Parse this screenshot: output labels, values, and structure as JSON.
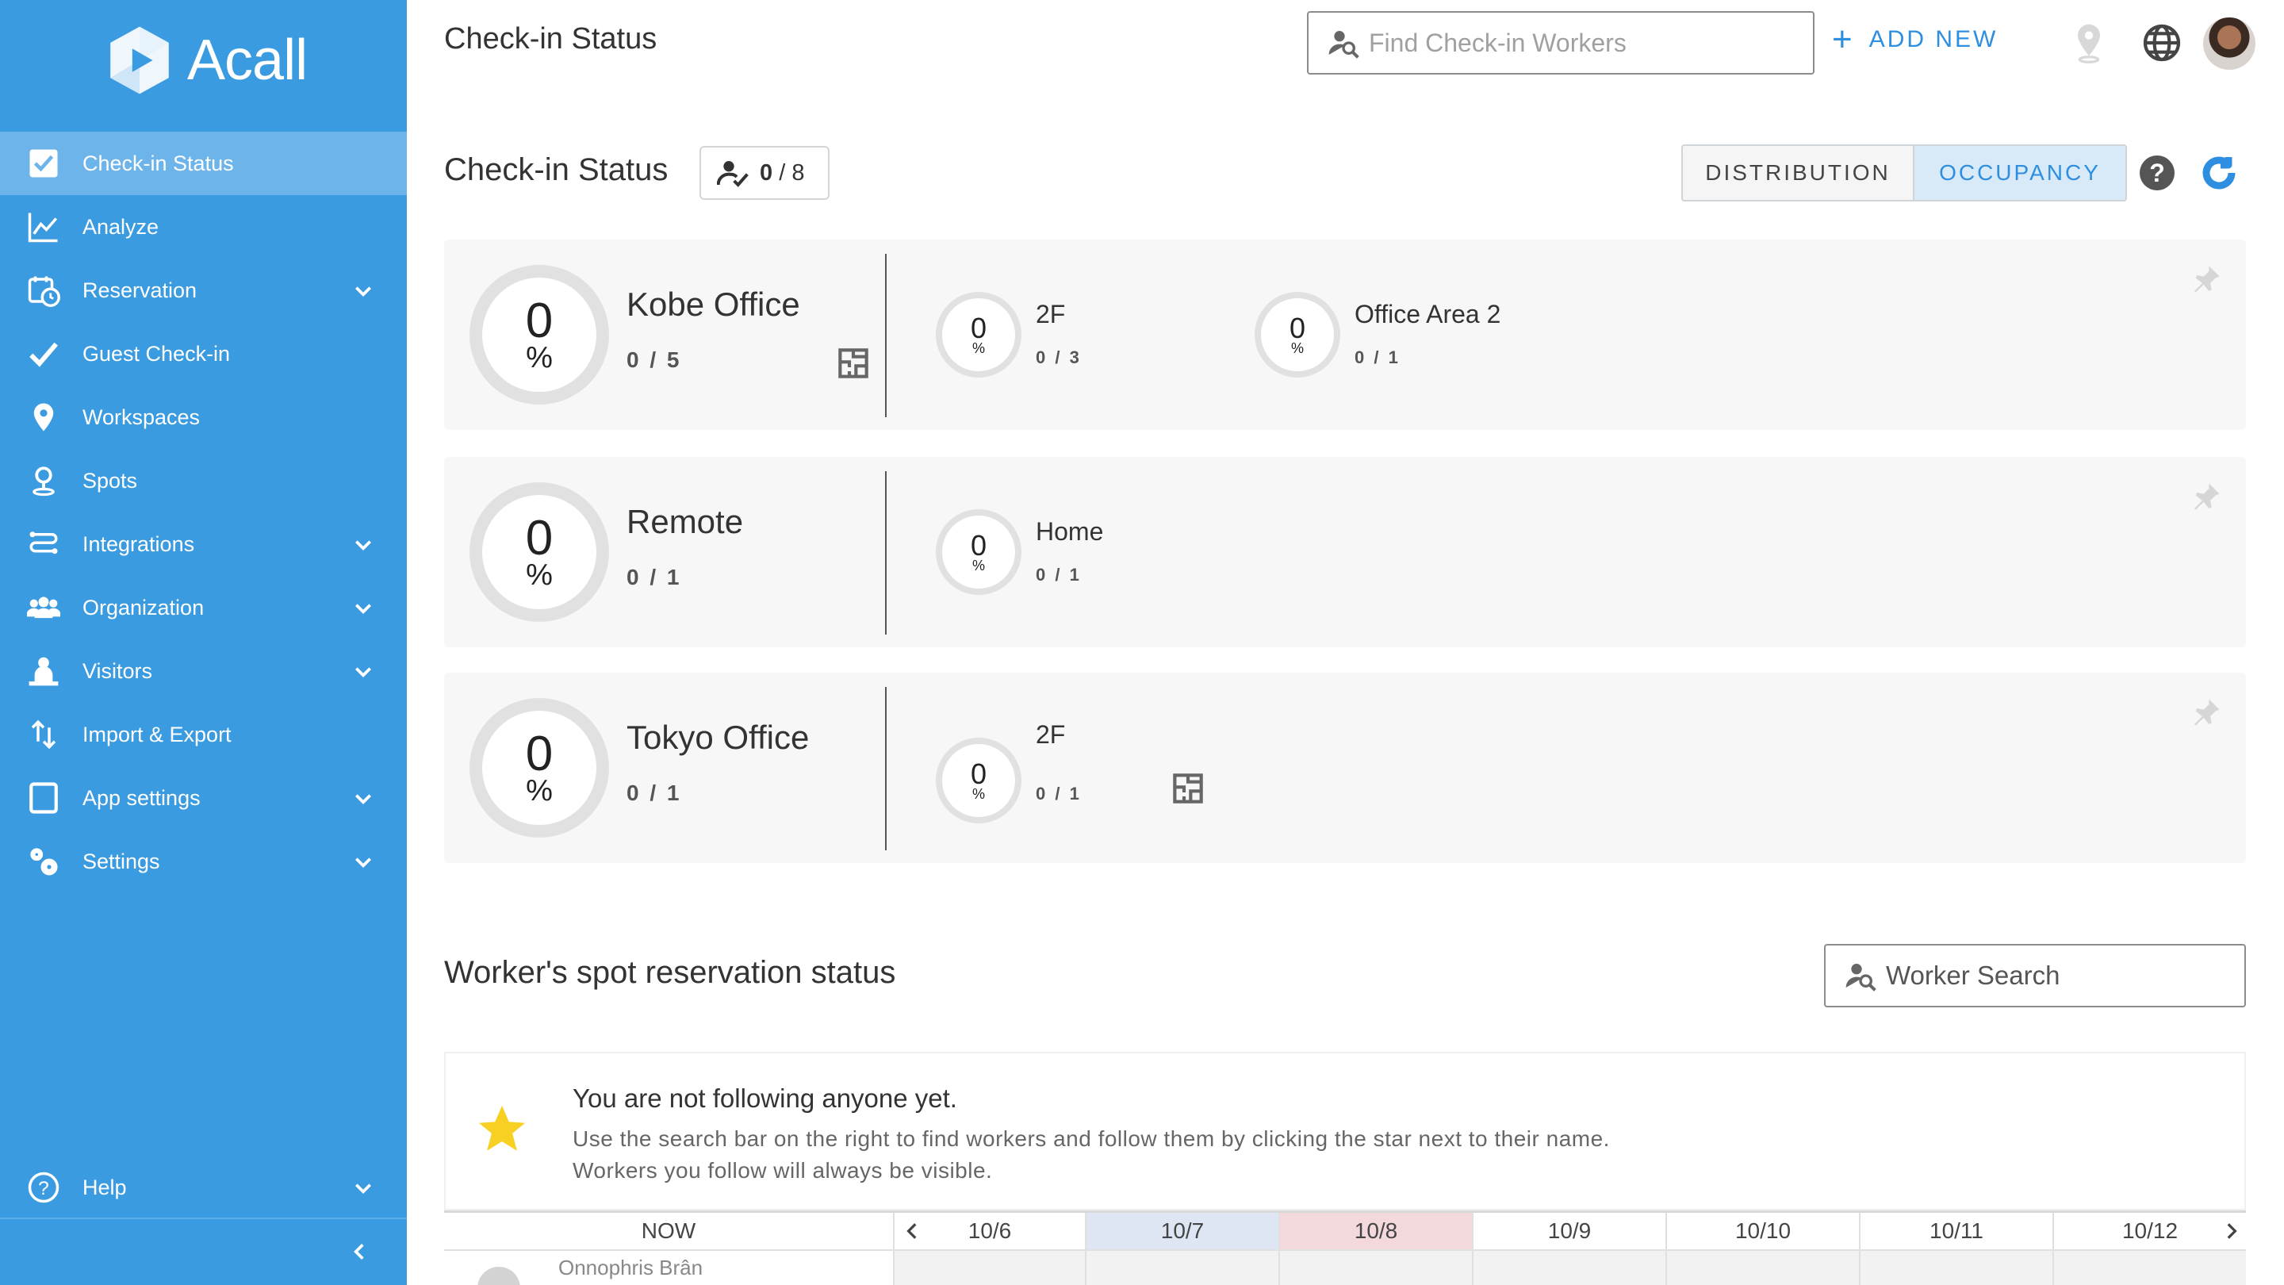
{
  "app": {
    "logo_text": "Acall",
    "topbar_title": "Check-in Status"
  },
  "sidebar": {
    "items": [
      {
        "label": "Check-in Status",
        "icon": "checkbox-icon",
        "active": true,
        "has_chevron": false
      },
      {
        "label": "Analyze",
        "icon": "line-chart-icon",
        "active": false,
        "has_chevron": false
      },
      {
        "label": "Reservation",
        "icon": "calendar-clock-icon",
        "active": false,
        "has_chevron": true
      },
      {
        "label": "Guest Check-in",
        "icon": "checkmark-icon",
        "active": false,
        "has_chevron": false
      },
      {
        "label": "Workspaces",
        "icon": "map-pin-icon",
        "active": false,
        "has_chevron": false
      },
      {
        "label": "Spots",
        "icon": "spot-pin-icon",
        "active": false,
        "has_chevron": false
      },
      {
        "label": "Integrations",
        "icon": "integrations-icon",
        "active": false,
        "has_chevron": true
      },
      {
        "label": "Organization",
        "icon": "people-icon",
        "active": false,
        "has_chevron": true
      },
      {
        "label": "Visitors",
        "icon": "visitor-icon",
        "active": false,
        "has_chevron": true
      },
      {
        "label": "Import & Export",
        "icon": "import-export-icon",
        "active": false,
        "has_chevron": false
      },
      {
        "label": "App settings",
        "icon": "tablet-icon",
        "active": false,
        "has_chevron": true
      },
      {
        "label": "Settings",
        "icon": "gears-icon",
        "active": false,
        "has_chevron": true
      }
    ],
    "help_label": "Help"
  },
  "search": {
    "placeholder": "Find Check-in Workers"
  },
  "add_new_label": "ADD NEW",
  "checkin": {
    "title": "Check-in Status",
    "count": "0",
    "total": "/ 8",
    "tabs": {
      "distribution": "DISTRIBUTION",
      "occupancy": "OCCUPANCY"
    },
    "help": "?"
  },
  "locations": [
    {
      "name": "Kobe Office",
      "percent": "0",
      "pct_sign": "%",
      "count": "0 / 5",
      "subs": [
        {
          "name": "2F",
          "percent": "0",
          "pct_sign": "%",
          "count": "0 / 3"
        },
        {
          "name": "Office Area 2",
          "percent": "0",
          "pct_sign": "%",
          "count": "0 / 1"
        }
      ]
    },
    {
      "name": "Remote",
      "percent": "0",
      "pct_sign": "%",
      "count": "0 / 1",
      "subs": [
        {
          "name": "Home",
          "percent": "0",
          "pct_sign": "%",
          "count": "0 / 1"
        }
      ]
    },
    {
      "name": "Tokyo Office",
      "percent": "0",
      "pct_sign": "%",
      "count": "0 / 1",
      "subs": [
        {
          "name": "2F",
          "percent": "0",
          "pct_sign": "%",
          "count": "0 / 1"
        }
      ]
    }
  ],
  "worker": {
    "title": "Worker's spot reservation status",
    "search_placeholder": "Worker Search",
    "empty_title": "You are not following anyone yet.",
    "empty_line1": "Use the search bar on the right to find workers and follow them by clicking the star next to their name.",
    "empty_line2": "Workers you follow will always be visible."
  },
  "calendar": {
    "now_label": "NOW",
    "dates": [
      "10/6",
      "10/7",
      "10/8",
      "10/9",
      "10/10",
      "10/11",
      "10/12"
    ],
    "highlight_colors": {
      "10/7": "#dde6f2",
      "10/8": "#f4d9dc"
    },
    "rows": [
      {
        "name": "Onnophris Brân"
      }
    ]
  },
  "colors": {
    "sidebar": "#3b9be0",
    "accent": "#2e8fe0",
    "star": "#f8d024"
  }
}
